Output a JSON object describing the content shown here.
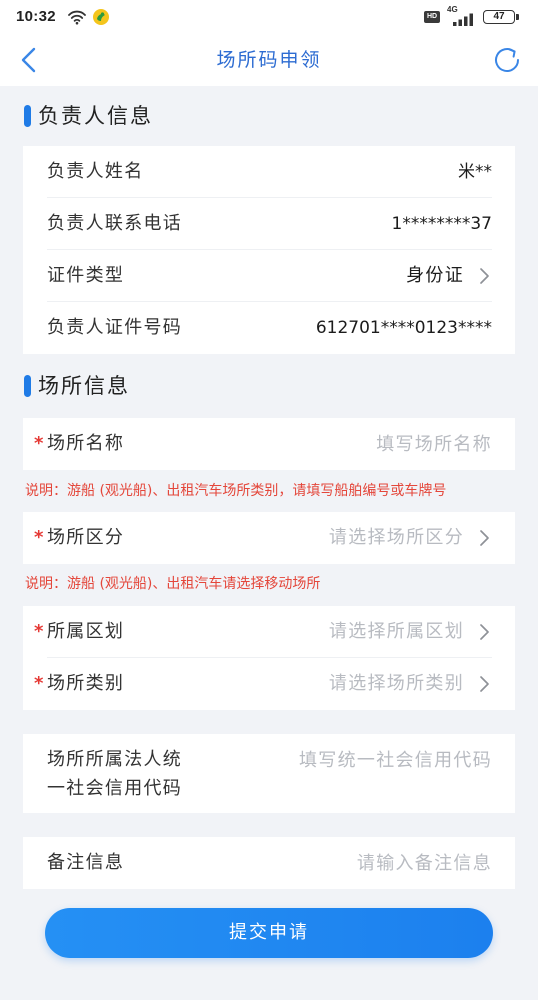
{
  "status_bar": {
    "time": "10:32",
    "hd": "HD",
    "network": "4G",
    "battery": "47"
  },
  "header": {
    "title": "场所码申领"
  },
  "owner_info": {
    "title": "负责人信息",
    "rows": [
      {
        "label": "负责人姓名",
        "value": "米**"
      },
      {
        "label": "负责人联系电话",
        "value": "1********37"
      },
      {
        "label": "证件类型",
        "value": "身份证"
      },
      {
        "label": "负责人证件号码",
        "value": "612701****0123****"
      }
    ]
  },
  "venue_info": {
    "title": "场所信息",
    "required_mark": "*",
    "venue_name": {
      "label": "场所名称",
      "placeholder": "填写场所名称"
    },
    "note_name": "说明：游船 (观光船)、出租汽车场所类别，请填写船舶编号或车牌号",
    "venue_type": {
      "label": "场所区分",
      "placeholder": "请选择场所区分"
    },
    "note_type": "说明：游船 (观光船)、出租汽车请选择移动场所",
    "region": {
      "label": "所属区划",
      "placeholder": "请选择所属区划"
    },
    "category": {
      "label": "场所类别",
      "placeholder": "请选择场所类别"
    },
    "credit_code": {
      "label_line1": "场所所属法人统",
      "label_line2": "一社会信用代码",
      "placeholder": "填写统一社会信用代码"
    },
    "remark": {
      "label": "备注信息",
      "placeholder": "请输入备注信息"
    }
  },
  "submit": {
    "label": "提交申请"
  },
  "colors": {
    "accent": "#1f7be6",
    "title": "#2d6cd2",
    "required": "#e53935",
    "note": "#e4473b",
    "button": "#1c80ee",
    "bg": "#f1f3f7"
  },
  "icons": {
    "back": "back-arrow-icon",
    "refresh": "refresh-icon",
    "chevron": "chevron-right-icon",
    "wifi": "wifi-icon",
    "signal": "signal-icon",
    "battery": "battery-icon",
    "app": "app-notification-icon"
  }
}
